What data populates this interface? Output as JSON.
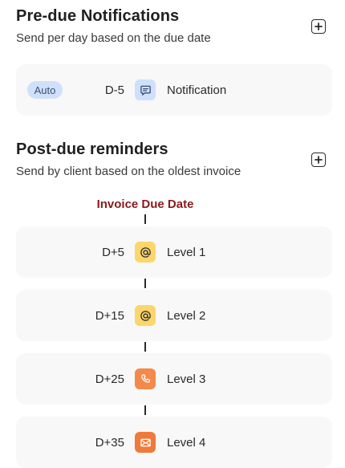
{
  "pre_due": {
    "title": "Pre-due Notifications",
    "subtitle": "Send per day based on the due date",
    "items": [
      {
        "badge": "Auto",
        "day": "D-5",
        "icon": "chat-message-icon",
        "label": "Notification",
        "icon_bg": "#cfe0fb",
        "icon_color": "#3b4f74"
      }
    ]
  },
  "post_due": {
    "title": "Post-due reminders",
    "subtitle": "Send by client based on the oldest invoice",
    "anchor_label": "Invoice Due Date",
    "items": [
      {
        "day": "D+5",
        "icon": "at-sign-icon",
        "label": "Level 1",
        "icon_bg": "#fbd66a",
        "icon_color": "#2a2a2a"
      },
      {
        "day": "D+15",
        "icon": "at-sign-icon",
        "label": "Level 2",
        "icon_bg": "#fbd66a",
        "icon_color": "#2a2a2a"
      },
      {
        "day": "D+25",
        "icon": "phone-icon",
        "label": "Level 3",
        "icon_bg": "#f3894a",
        "icon_color": "#ffffff"
      },
      {
        "day": "D+35",
        "icon": "envelope-icon",
        "label": "Level 4",
        "icon_bg": "#ef7a3a",
        "icon_color": "#ffffff"
      }
    ]
  },
  "colors": {
    "anchor_label": "#8b1a1a",
    "card_bg": "#f8f8f8"
  }
}
